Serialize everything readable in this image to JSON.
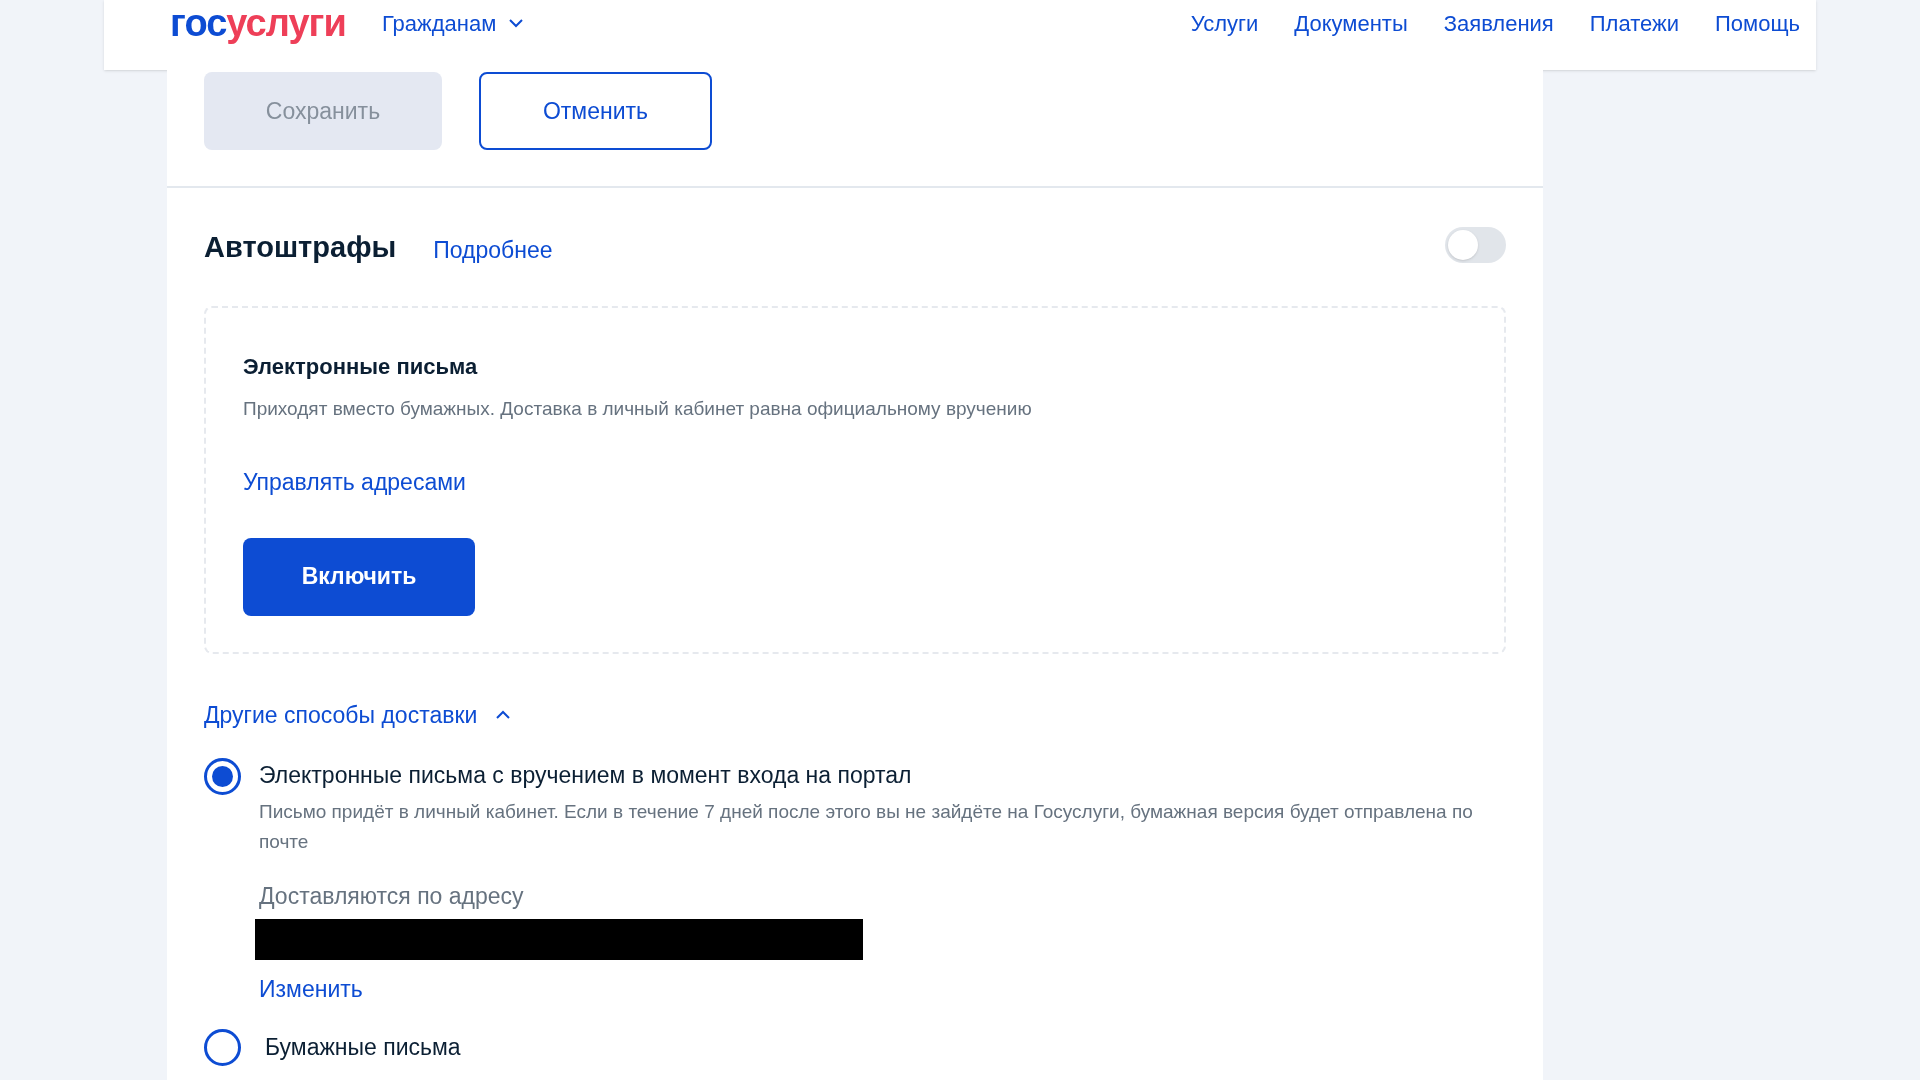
{
  "header": {
    "logo": {
      "first": "гос",
      "second": "услуги"
    },
    "audience": "Гражданам",
    "nav": [
      "Услуги",
      "Документы",
      "Заявления",
      "Платежи",
      "Помощь"
    ]
  },
  "actions": {
    "save": {
      "label": "Сохранить",
      "disabled": true
    },
    "cancel": {
      "label": "Отменить"
    }
  },
  "section": {
    "title": "Автоштрафы",
    "more": "Подробнее",
    "on": false,
    "card": {
      "title": "Электронные письма",
      "description": "Приходят вместо бумажных. Доставка в личный кабинет равна официальному вручению",
      "manage": "Управлять адресами",
      "enable": "Включить"
    },
    "other": {
      "label": "Другие способы доставки",
      "expanded": true,
      "options": [
        {
          "label": "Электронные письма с вручением в момент входа на портал",
          "selected": true,
          "description": "Письмо придёт в личный кабинет. Если в течение 7 дней после этого вы не зайдёте на Госуслуги, бумажная версия будет отправлена по почте",
          "address_label": "Доставляются по адресу",
          "change": "Изменить"
        },
        {
          "label": "Бумажные письма",
          "selected": false
        }
      ]
    }
  }
}
